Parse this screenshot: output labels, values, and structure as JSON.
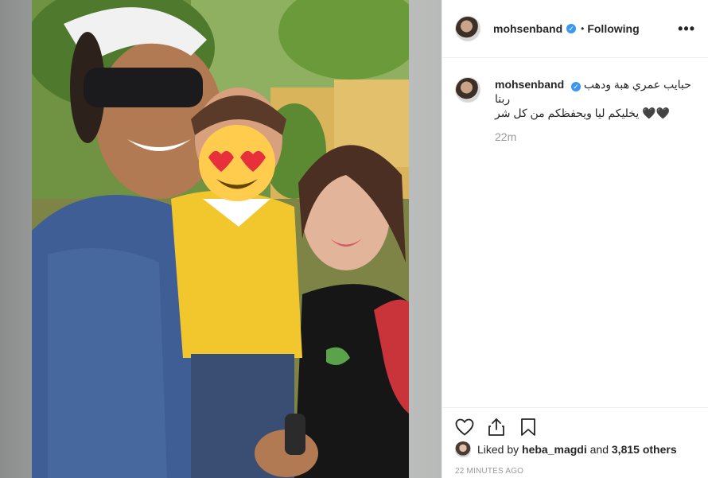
{
  "post": {
    "photo_alt": "",
    "author": {
      "username": "mohsenband",
      "verified_icon": "verified-badge-icon",
      "follow_separator": "•",
      "follow_status": "Following",
      "more_icon": "more-options-icon",
      "more_label": "•••"
    },
    "caption": {
      "username": "mohsenband",
      "line1": "حبايب عمري هبة ودهب ربنا",
      "line2": "🖤🖤 يخليكم ليا ويحفظكم من كل شر",
      "time": "22m"
    },
    "actions": {
      "like_icon": "heart-icon",
      "share_icon": "share-icon",
      "save_icon": "bookmark-icon"
    },
    "likes": {
      "prefix": "Liked by",
      "liker": "heba_magdi",
      "connector": "and",
      "others": "3,815 others"
    },
    "timestamp": "22 MINUTES AGO"
  },
  "colors": {
    "accent_verified": "#3897f0",
    "text_primary": "#262626",
    "text_muted": "#999999",
    "border": "#efefef"
  }
}
